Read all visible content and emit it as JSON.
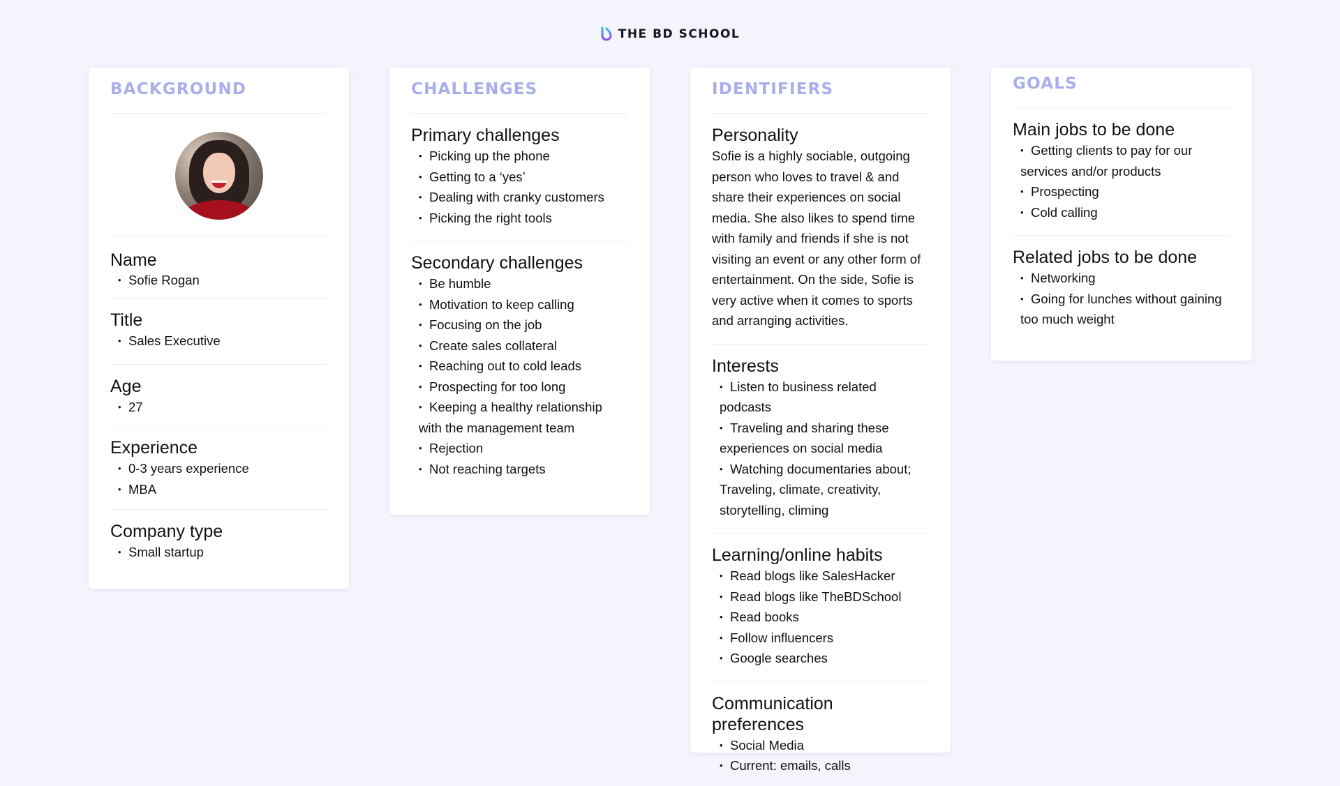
{
  "brand": {
    "logo_icon": "bd-school-droplet-icon",
    "name": "THE BD SCHOOL",
    "accent_gradient": [
      "#3fb8e8",
      "#8a4de8"
    ]
  },
  "colors": {
    "background": "#f4f4fc",
    "card_title": "#a8aeec",
    "card": "#ffffff",
    "divider": "#efeff4"
  },
  "background": {
    "title": "BACKGROUND",
    "avatar": "profile-photo",
    "sections": [
      {
        "heading": "Name",
        "items": [
          "Sofie Rogan"
        ]
      },
      {
        "heading": "Title",
        "items": [
          "Sales Executive"
        ]
      },
      {
        "heading": "Age",
        "items": [
          "27"
        ]
      },
      {
        "heading": "Experience",
        "items": [
          "0-3 years experience",
          "MBA"
        ]
      },
      {
        "heading": "Company type",
        "items": [
          "Small startup"
        ]
      }
    ]
  },
  "challenges": {
    "title": "CHALLENGES",
    "sections": [
      {
        "heading": "Primary challenges",
        "items": [
          "Picking up the phone",
          "Getting to a ‘yes’",
          "Dealing with cranky customers",
          "Picking the right tools"
        ]
      },
      {
        "heading": "Secondary challenges",
        "items": [
          "Be humble",
          "Motivation to keep calling",
          "Focusing on the job",
          "Create sales collateral",
          "Reaching out to cold leads",
          "Prospecting for too long",
          "Keeping a healthy relationship with the management team",
          "Rejection",
          "Not reaching targets"
        ]
      }
    ]
  },
  "identifiers": {
    "title": "IDENTIFIERS",
    "personality": {
      "heading": "Personality",
      "text": "Sofie is a highly sociable, outgoing person who loves to travel & and share their experiences on social media. She also likes to spend time with family and friends if she is not visiting an event or any other form of entertainment. On the side, Sofie is very active when it comes to sports and arranging activities."
    },
    "sections": [
      {
        "heading": "Interests",
        "items": [
          "Listen to business related podcasts",
          "Traveling and sharing these experiences on social media",
          "Watching documentaries about; Traveling, climate, creativity, storytelling, climing"
        ]
      },
      {
        "heading": "Learning/online habits",
        "items": [
          "Read blogs like SalesHacker",
          "Read blogs like TheBDSchool",
          "Read books",
          "Follow influencers",
          "Google searches"
        ]
      },
      {
        "heading": "Communication preferences",
        "items": [
          "Social Media",
          "Current: emails, calls"
        ]
      }
    ]
  },
  "goals": {
    "title": "GOALS",
    "sections": [
      {
        "heading": "Main jobs to be done",
        "items": [
          "Getting clients to pay for our services and/or products",
          "Prospecting",
          "Cold calling"
        ]
      },
      {
        "heading": "Related jobs to be done",
        "items": [
          "Networking",
          "Going for lunches without gaining too much weight"
        ]
      }
    ]
  }
}
